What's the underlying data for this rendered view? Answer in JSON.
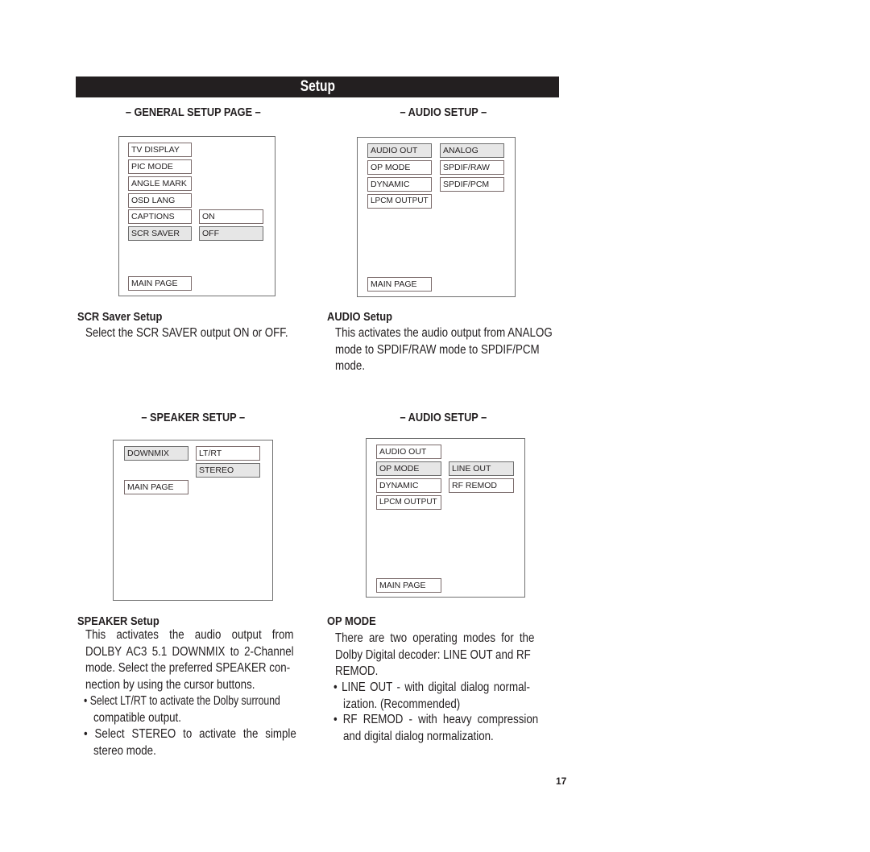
{
  "header": {
    "title": "Setup"
  },
  "panels": {
    "general": {
      "title": "– GENERAL SETUP PAGE –",
      "items": [
        "TV DISPLAY",
        "PIC MODE",
        "ANGLE MARK",
        "OSD LANG",
        "CAPTIONS",
        "SCR SAVER"
      ],
      "values": [
        "ON",
        "OFF"
      ],
      "main_page": "MAIN PAGE",
      "selected_item": "SCR SAVER",
      "selected_value": "OFF"
    },
    "audio1": {
      "title": "– AUDIO SETUP –",
      "items": [
        "AUDIO OUT",
        "OP MODE",
        "DYNAMIC",
        "LPCM OUTPUT"
      ],
      "values": [
        "ANALOG",
        "SPDIF/RAW",
        "SPDIF/PCM"
      ],
      "main_page": "MAIN PAGE",
      "selected_item": "AUDIO OUT",
      "selected_value": "ANALOG"
    },
    "speaker": {
      "title": "– SPEAKER SETUP –",
      "items": [
        "DOWNMIX"
      ],
      "values": [
        "LT/RT",
        "STEREO"
      ],
      "main_page": "MAIN PAGE",
      "selected_item": "DOWNMIX",
      "selected_value": "STEREO"
    },
    "audio2": {
      "title": "– AUDIO SETUP –",
      "items": [
        "AUDIO OUT",
        "OP MODE",
        "DYNAMIC",
        "LPCM OUTPUT"
      ],
      "values": [
        "LINE OUT",
        "RF REMOD"
      ],
      "main_page": "MAIN PAGE",
      "selected_item": "OP MODE",
      "selected_value": "LINE OUT"
    }
  },
  "descriptions": {
    "scr_saver": {
      "heading": "SCR Saver Setup",
      "text": "Select the SCR SAVER output ON or OFF."
    },
    "audio": {
      "heading": "AUDIO Setup",
      "lines": [
        "This activates the audio output from ANALOG",
        "mode to SPDIF/RAW mode to SPDIF/PCM",
        "mode."
      ]
    },
    "speaker": {
      "heading": "SPEAKER Setup",
      "lines": [
        "This activates the audio output from",
        "DOLBY AC3 5.1 DOWNMIX to 2-Channel",
        "mode. Select the preferred SPEAKER con-",
        "nection by using the cursor buttons."
      ],
      "bullets": [
        [
          "• Select LT/RT to activate the Dolby surround",
          "compatible output."
        ],
        [
          "• Select STEREO to activate the simple",
          "stereo mode."
        ]
      ]
    },
    "op_mode": {
      "heading": "OP MODE",
      "lines": [
        "There are two operating modes for the",
        "Dolby Digital decoder: LINE OUT and RF",
        "REMOD."
      ],
      "bullets": [
        [
          "• LINE OUT - with digital dialog normal-",
          "ization. (Recommended)"
        ],
        [
          "• RF REMOD - with heavy compression",
          "and digital dialog normalization."
        ]
      ]
    }
  },
  "page_number": "17"
}
